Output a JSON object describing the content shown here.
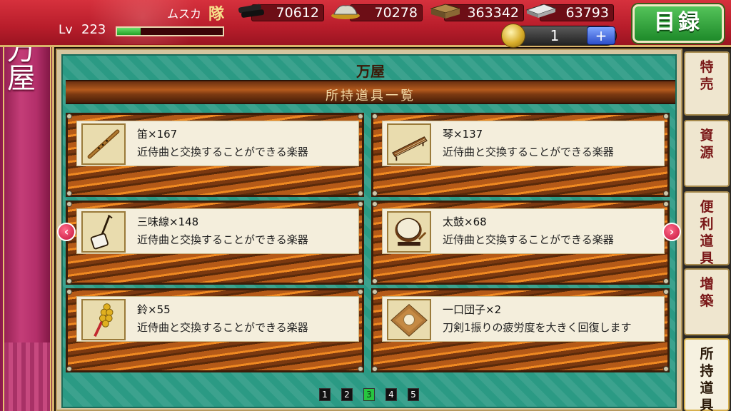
{
  "header": {
    "username": "ムスカ",
    "unit_kanji": "隊",
    "level_label": "Lv",
    "level": "223",
    "exp_fraction": 0.22,
    "resources": [
      {
        "icon": "charcoal-icon",
        "value": "70612"
      },
      {
        "icon": "jade-steel-icon",
        "value": "70278"
      },
      {
        "icon": "cooling-material-icon",
        "value": "363342"
      },
      {
        "icon": "whetstone-icon",
        "value": "63793"
      }
    ],
    "coin_count": "1",
    "coin_plus": "+",
    "menu_label": "目録"
  },
  "left_banner": {
    "title": "万屋"
  },
  "main": {
    "shop_name": "万屋",
    "section_title": "所持道具一覧",
    "items": [
      {
        "name": "笛×167",
        "desc": "近侍曲と交換することができる楽器",
        "icon": "flute-icon"
      },
      {
        "name": "琴×137",
        "desc": "近侍曲と交換することができる楽器",
        "icon": "koto-icon"
      },
      {
        "name": "三味線×148",
        "desc": "近侍曲と交換することができる楽器",
        "icon": "shamisen-icon"
      },
      {
        "name": "太鼓×68",
        "desc": "近侍曲と交換することができる楽器",
        "icon": "taiko-drum-icon"
      },
      {
        "name": "鈴×55",
        "desc": "近侍曲と交換することができる楽器",
        "icon": "bell-icon"
      },
      {
        "name": "一口団子×2",
        "desc": "刀剣1振りの疲労度を大きく回復します",
        "icon": "dango-icon"
      }
    ],
    "arrows": {
      "prev": "‹",
      "next": "›"
    },
    "pages": [
      "1",
      "2",
      "3",
      "4",
      "5"
    ],
    "current_page": "3"
  },
  "tabs": [
    {
      "label": "特売"
    },
    {
      "label": "資源"
    },
    {
      "label": "便利道具"
    },
    {
      "label": "増築"
    },
    {
      "label": "所持道具",
      "active": true
    }
  ]
}
